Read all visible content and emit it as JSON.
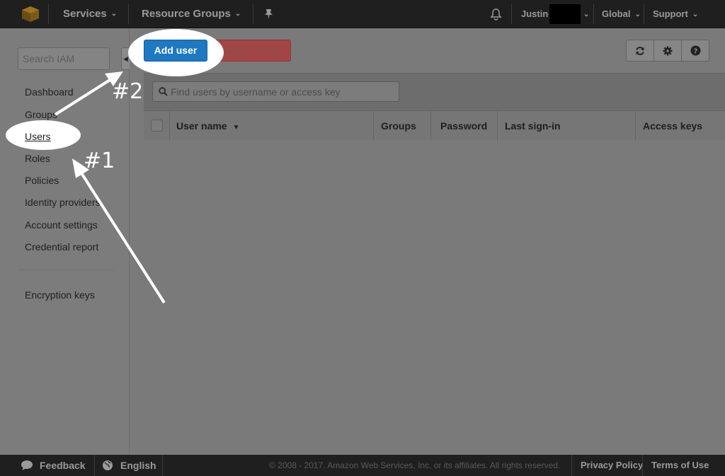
{
  "topnav": {
    "services": "Services",
    "resource_groups": "Resource Groups",
    "user": "Justin",
    "region": "Global",
    "support": "Support"
  },
  "sidebar": {
    "search_placeholder": "Search IAM",
    "items": [
      {
        "label": "Dashboard"
      },
      {
        "label": "Groups"
      },
      {
        "label": "Users",
        "active": true
      },
      {
        "label": "Roles"
      },
      {
        "label": "Policies"
      },
      {
        "label": "Identity providers"
      },
      {
        "label": "Account settings"
      },
      {
        "label": "Credential report"
      }
    ],
    "extra_items": [
      {
        "label": "Encryption keys"
      }
    ]
  },
  "toolbar": {
    "add_user": "Add user",
    "delete_users": "Delete users",
    "icons": [
      "refresh-icon",
      "gear-icon",
      "help-icon"
    ]
  },
  "users_table": {
    "search_placeholder": "Find users by username or access key",
    "columns": [
      "User name",
      "Groups",
      "Password",
      "Last sign-in",
      "Access keys"
    ],
    "rows": []
  },
  "footer": {
    "feedback": "Feedback",
    "language": "English",
    "copyright": "© 2008 - 2017, Amazon Web Services, Inc. or its affiliates. All rights reserved.",
    "privacy": "Privacy Policy",
    "terms": "Terms of Use"
  },
  "annotations": {
    "step1": "#1",
    "step2": "#2"
  },
  "colors": {
    "accent_active": "#e08a00",
    "primary_button": "#1e78c2",
    "danger_button": "#a44545",
    "nav_bg": "#1f1f1f"
  }
}
